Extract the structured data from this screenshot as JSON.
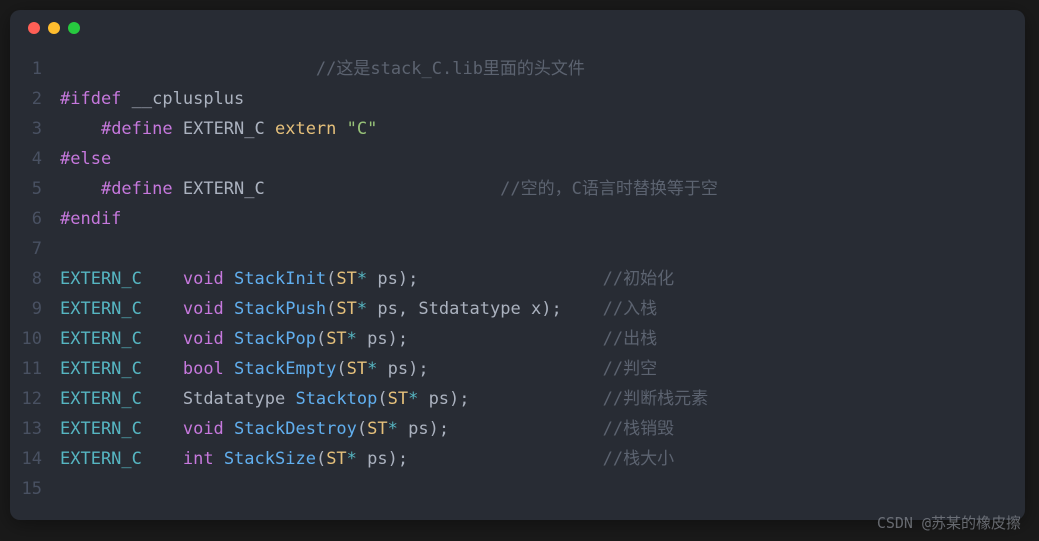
{
  "lines": [
    {
      "n": "1",
      "segs": [
        {
          "c": "code",
          "t": "                         "
        },
        {
          "c": "comment",
          "t": "//这是stack_C.lib里面的头文件"
        }
      ]
    },
    {
      "n": "2",
      "segs": [
        {
          "c": "preproc",
          "t": "#ifdef"
        },
        {
          "c": "code",
          "t": " "
        },
        {
          "c": "define-name",
          "t": "__cplusplus"
        }
      ]
    },
    {
      "n": "3",
      "segs": [
        {
          "c": "code",
          "t": "    "
        },
        {
          "c": "preproc",
          "t": "#define"
        },
        {
          "c": "code",
          "t": " "
        },
        {
          "c": "define-name",
          "t": "EXTERN_C "
        },
        {
          "c": "kw-extern",
          "t": "extern"
        },
        {
          "c": "code",
          "t": " "
        },
        {
          "c": "str",
          "t": "\"C\""
        }
      ]
    },
    {
      "n": "4",
      "segs": [
        {
          "c": "preproc",
          "t": "#else"
        }
      ]
    },
    {
      "n": "5",
      "segs": [
        {
          "c": "code",
          "t": "    "
        },
        {
          "c": "preproc",
          "t": "#define"
        },
        {
          "c": "code",
          "t": " "
        },
        {
          "c": "define-name",
          "t": "EXTERN_C"
        },
        {
          "c": "code",
          "t": "                       "
        },
        {
          "c": "comment",
          "t": "//空的，C语言时替换等于空"
        }
      ]
    },
    {
      "n": "6",
      "segs": [
        {
          "c": "preproc",
          "t": "#endif"
        }
      ]
    },
    {
      "n": "7",
      "segs": []
    },
    {
      "n": "8",
      "segs": [
        {
          "c": "ident-const",
          "t": "EXTERN_C"
        },
        {
          "c": "code",
          "t": "    "
        },
        {
          "c": "type-void",
          "t": "void"
        },
        {
          "c": "code",
          "t": " "
        },
        {
          "c": "func",
          "t": "StackInit"
        },
        {
          "c": "punct",
          "t": "("
        },
        {
          "c": "type-st",
          "t": "ST"
        },
        {
          "c": "op",
          "t": "*"
        },
        {
          "c": "code",
          "t": " "
        },
        {
          "c": "param",
          "t": "ps"
        },
        {
          "c": "punct",
          "t": ")"
        },
        {
          "c": "punct",
          "t": ";"
        },
        {
          "c": "code",
          "t": "                  "
        },
        {
          "c": "comment",
          "t": "//初始化"
        }
      ]
    },
    {
      "n": "9",
      "segs": [
        {
          "c": "ident-const",
          "t": "EXTERN_C"
        },
        {
          "c": "code",
          "t": "    "
        },
        {
          "c": "type-void",
          "t": "void"
        },
        {
          "c": "code",
          "t": " "
        },
        {
          "c": "func",
          "t": "StackPush"
        },
        {
          "c": "punct",
          "t": "("
        },
        {
          "c": "type-st",
          "t": "ST"
        },
        {
          "c": "op",
          "t": "*"
        },
        {
          "c": "code",
          "t": " "
        },
        {
          "c": "param",
          "t": "ps"
        },
        {
          "c": "punct",
          "t": ", "
        },
        {
          "c": "type-std",
          "t": "Stdatatype x"
        },
        {
          "c": "punct",
          "t": ")"
        },
        {
          "c": "punct",
          "t": ";"
        },
        {
          "c": "code",
          "t": "    "
        },
        {
          "c": "comment",
          "t": "//入栈"
        }
      ]
    },
    {
      "n": "10",
      "segs": [
        {
          "c": "ident-const",
          "t": "EXTERN_C"
        },
        {
          "c": "code",
          "t": "    "
        },
        {
          "c": "type-void",
          "t": "void"
        },
        {
          "c": "code",
          "t": " "
        },
        {
          "c": "func",
          "t": "StackPop"
        },
        {
          "c": "punct",
          "t": "("
        },
        {
          "c": "type-st",
          "t": "ST"
        },
        {
          "c": "op",
          "t": "*"
        },
        {
          "c": "code",
          "t": " "
        },
        {
          "c": "param",
          "t": "ps"
        },
        {
          "c": "punct",
          "t": ")"
        },
        {
          "c": "punct",
          "t": ";"
        },
        {
          "c": "code",
          "t": "                   "
        },
        {
          "c": "comment",
          "t": "//出栈"
        }
      ]
    },
    {
      "n": "11",
      "segs": [
        {
          "c": "ident-const",
          "t": "EXTERN_C"
        },
        {
          "c": "code",
          "t": "    "
        },
        {
          "c": "type-bool",
          "t": "bool"
        },
        {
          "c": "code",
          "t": " "
        },
        {
          "c": "func",
          "t": "StackEmpty"
        },
        {
          "c": "punct",
          "t": "("
        },
        {
          "c": "type-st",
          "t": "ST"
        },
        {
          "c": "op",
          "t": "*"
        },
        {
          "c": "code",
          "t": " "
        },
        {
          "c": "param",
          "t": "ps"
        },
        {
          "c": "punct",
          "t": ")"
        },
        {
          "c": "punct",
          "t": ";"
        },
        {
          "c": "code",
          "t": "                 "
        },
        {
          "c": "comment",
          "t": "//判空"
        }
      ]
    },
    {
      "n": "12",
      "segs": [
        {
          "c": "ident-const",
          "t": "EXTERN_C"
        },
        {
          "c": "code",
          "t": "    "
        },
        {
          "c": "type-std",
          "t": "Stdatatype "
        },
        {
          "c": "func",
          "t": "Stacktop"
        },
        {
          "c": "punct",
          "t": "("
        },
        {
          "c": "type-st",
          "t": "ST"
        },
        {
          "c": "op",
          "t": "*"
        },
        {
          "c": "code",
          "t": " "
        },
        {
          "c": "param",
          "t": "ps"
        },
        {
          "c": "punct",
          "t": ")"
        },
        {
          "c": "punct",
          "t": ";"
        },
        {
          "c": "code",
          "t": "             "
        },
        {
          "c": "comment",
          "t": "//判断栈元素"
        }
      ]
    },
    {
      "n": "13",
      "segs": [
        {
          "c": "ident-const",
          "t": "EXTERN_C"
        },
        {
          "c": "code",
          "t": "    "
        },
        {
          "c": "type-void",
          "t": "void"
        },
        {
          "c": "code",
          "t": " "
        },
        {
          "c": "func",
          "t": "StackDestroy"
        },
        {
          "c": "punct",
          "t": "("
        },
        {
          "c": "type-st",
          "t": "ST"
        },
        {
          "c": "op",
          "t": "*"
        },
        {
          "c": "code",
          "t": " "
        },
        {
          "c": "param",
          "t": "ps"
        },
        {
          "c": "punct",
          "t": ")"
        },
        {
          "c": "punct",
          "t": ";"
        },
        {
          "c": "code",
          "t": "               "
        },
        {
          "c": "comment",
          "t": "//栈销毁"
        }
      ]
    },
    {
      "n": "14",
      "segs": [
        {
          "c": "ident-const",
          "t": "EXTERN_C"
        },
        {
          "c": "code",
          "t": "    "
        },
        {
          "c": "type-int",
          "t": "int"
        },
        {
          "c": "code",
          "t": " "
        },
        {
          "c": "func",
          "t": "StackSize"
        },
        {
          "c": "punct",
          "t": "("
        },
        {
          "c": "type-st",
          "t": "ST"
        },
        {
          "c": "op",
          "t": "*"
        },
        {
          "c": "code",
          "t": " "
        },
        {
          "c": "param",
          "t": "ps"
        },
        {
          "c": "punct",
          "t": ")"
        },
        {
          "c": "punct",
          "t": ";"
        },
        {
          "c": "code",
          "t": "                   "
        },
        {
          "c": "comment",
          "t": "//栈大小"
        }
      ]
    },
    {
      "n": "15",
      "segs": []
    }
  ],
  "watermark": "CSDN @苏某的橡皮擦"
}
